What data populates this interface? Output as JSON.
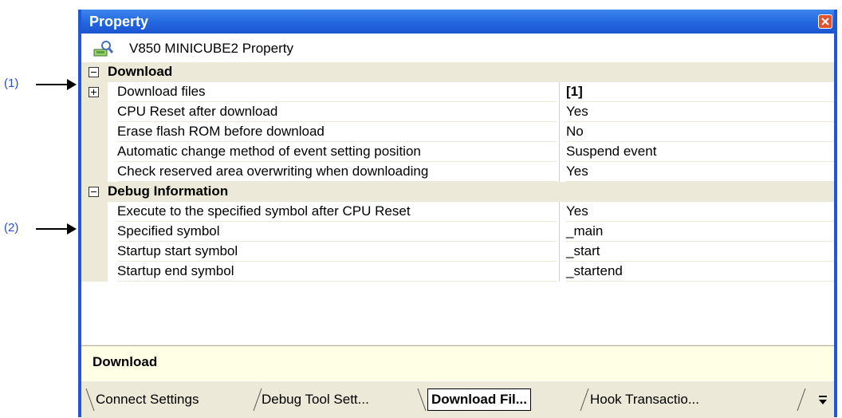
{
  "callouts": [
    {
      "label": "(1)"
    },
    {
      "label": "(2)"
    }
  ],
  "window": {
    "title": "Property",
    "header": "V850 MINICUBE2 Property"
  },
  "categories": [
    {
      "name": "Download",
      "rows": [
        {
          "name": "Download files",
          "value": "[1]"
        },
        {
          "name": "CPU Reset after download",
          "value": "Yes"
        },
        {
          "name": "Erase flash ROM before download",
          "value": "No"
        },
        {
          "name": "Automatic change method of event setting position",
          "value": "Suspend event"
        },
        {
          "name": "Check reserved area overwriting when downloading",
          "value": "Yes"
        }
      ]
    },
    {
      "name": "Debug Information",
      "rows": [
        {
          "name": "Execute to the specified symbol after CPU Reset",
          "value": "Yes"
        },
        {
          "name": "Specified symbol",
          "value": "_main"
        },
        {
          "name": "Startup start symbol",
          "value": "_start"
        },
        {
          "name": "Startup end symbol",
          "value": "_startend"
        }
      ]
    }
  ],
  "description": "Download",
  "tabs": [
    {
      "label": "Connect Settings"
    },
    {
      "label": "Debug Tool Sett..."
    },
    {
      "label": "Download Fil..."
    },
    {
      "label": "Hook Transactio..."
    }
  ],
  "colors": {
    "title_bar": "#2366df",
    "callout_text": "#2a4fd6",
    "close_button": "#e2522e",
    "description_bg": "#ffffe6"
  }
}
